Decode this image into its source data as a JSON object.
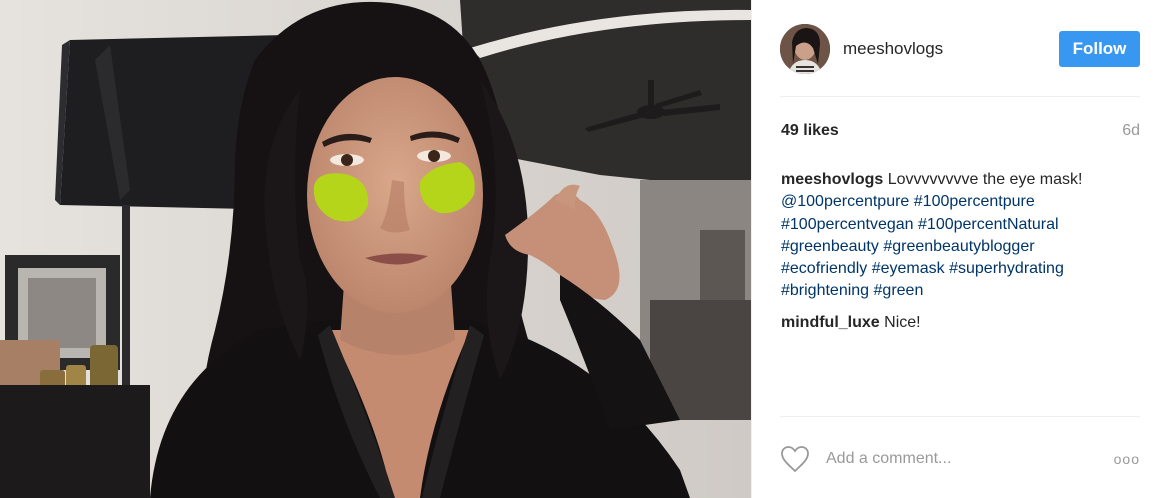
{
  "post": {
    "image_alt": "Selfie of a woman wearing green under-eye gel masks",
    "author": {
      "username": "meeshovlogs",
      "follow_label": "Follow"
    },
    "likes": "49 likes",
    "age": "6d",
    "caption": {
      "username": "meeshovlogs",
      "text": "Lovvvvvvvve the eye mask!",
      "tags": [
        "@100percentpure",
        "#100percentpure",
        "#100percentvegan",
        "#100percentNatural",
        "#greenbeauty",
        "#greenbeautyblogger",
        "#ecofriendly",
        "#eyemask",
        "#superhydrating",
        "#brightening",
        "#green"
      ]
    },
    "comments": [
      {
        "username": "mindful_luxe",
        "text": "Nice!"
      }
    ],
    "add_comment_placeholder": "Add a comment...",
    "more_label": "ooo"
  },
  "colors": {
    "follow_bg": "#3897f0",
    "hashtag": "#003569",
    "eye_mask": "#b5d51a"
  },
  "icons": [
    "heart-icon",
    "more-options-icon"
  ]
}
